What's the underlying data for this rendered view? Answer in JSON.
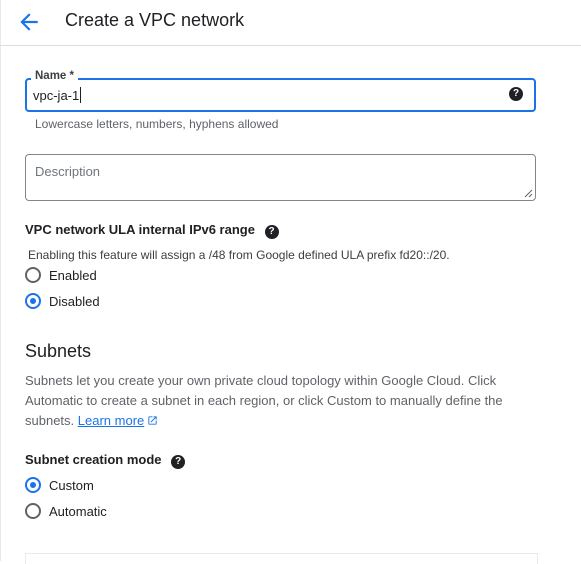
{
  "header": {
    "title": "Create a VPC network",
    "back_icon": "arrow-back-icon"
  },
  "form": {
    "name": {
      "label": "Name *",
      "value": "vpc-ja-1",
      "help_icon": "help-icon",
      "hint": "Lowercase letters, numbers, hyphens allowed"
    },
    "description": {
      "placeholder": "Description"
    },
    "ipv6": {
      "label": "VPC network ULA internal IPv6 range",
      "help_icon": "help-icon",
      "description": "Enabling this feature will assign a /48 from Google defined ULA prefix fd20::/20.",
      "options": [
        {
          "label": "Enabled",
          "checked": false
        },
        {
          "label": "Disabled",
          "checked": true
        }
      ]
    }
  },
  "subnets": {
    "title": "Subnets",
    "description": "Subnets let you create your own private cloud topology within Google Cloud. Click Automatic to create a subnet in each region, or click Custom to manually define the subnets.",
    "learn_more": "Learn more",
    "creation_mode": {
      "label": "Subnet creation mode",
      "options": [
        {
          "label": "Custom",
          "checked": true
        },
        {
          "label": "Automatic",
          "checked": false
        }
      ]
    }
  },
  "colors": {
    "accent": "#1a73e8",
    "text": "#202124",
    "muted": "#5f6368",
    "border": "#80868b"
  }
}
